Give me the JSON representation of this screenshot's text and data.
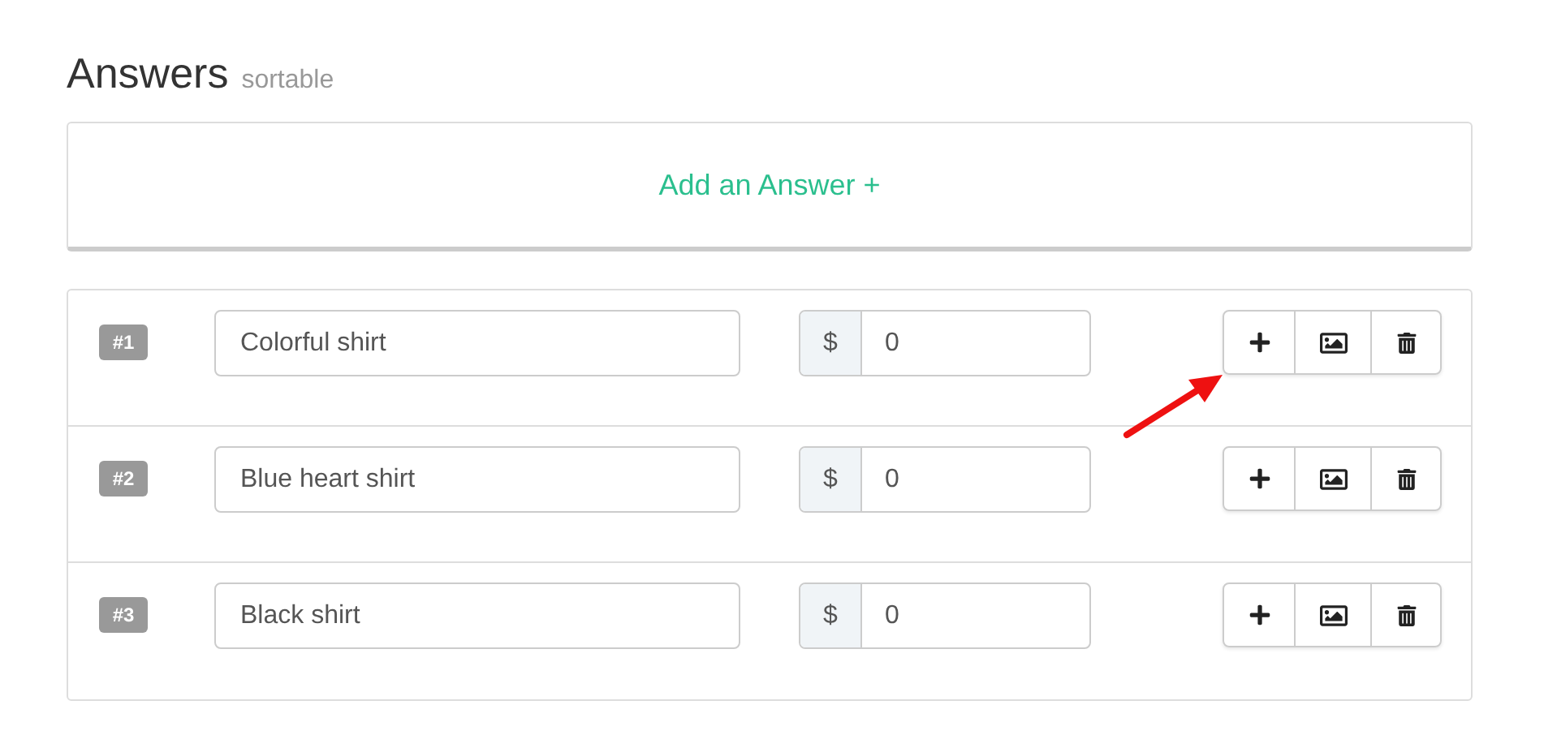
{
  "heading": {
    "title": "Answers",
    "subtitle": "sortable"
  },
  "add_button": {
    "label": "Add an Answer +"
  },
  "answers": [
    {
      "number": "#1",
      "name": "Colorful shirt",
      "currency": "$",
      "price": "0"
    },
    {
      "number": "#2",
      "name": "Blue heart shirt",
      "currency": "$",
      "price": "0"
    },
    {
      "number": "#3",
      "name": "Black shirt",
      "currency": "$",
      "price": "0"
    }
  ],
  "annotation": {
    "kind": "arrow",
    "color": "#ee1111"
  }
}
